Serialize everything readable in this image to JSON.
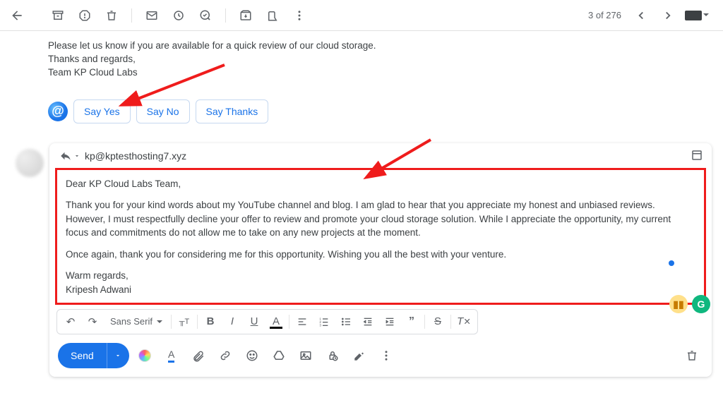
{
  "toolbar": {
    "counter": "3 of 276"
  },
  "previous_email": {
    "line1": "Please let us know if you are available for a quick review of our cloud storage.",
    "line2": "Thanks and regards,",
    "line3": "Team KP Cloud Labs"
  },
  "smart_replies": {
    "yes": "Say Yes",
    "no": "Say No",
    "thanks": "Say Thanks"
  },
  "compose": {
    "to_address": "kp@kptesthosting7.xyz",
    "body": {
      "greeting": "Dear KP Cloud Labs Team,",
      "p1": "Thank you for your kind words about my YouTube channel and blog. I am glad to hear that you appreciate my honest and unbiased reviews. However, I must respectfully decline your offer to review and promote your cloud storage solution. While I appreciate the opportunity, my current focus and commitments do not allow me to take on any new projects at the moment.",
      "p2": "Once again, thank you for considering me for this opportunity. Wishing you all the best with your venture.",
      "signoff1": "Warm regards,",
      "signoff2": "Kripesh Adwani"
    },
    "font_name": "Sans Serif",
    "send_label": "Send"
  }
}
